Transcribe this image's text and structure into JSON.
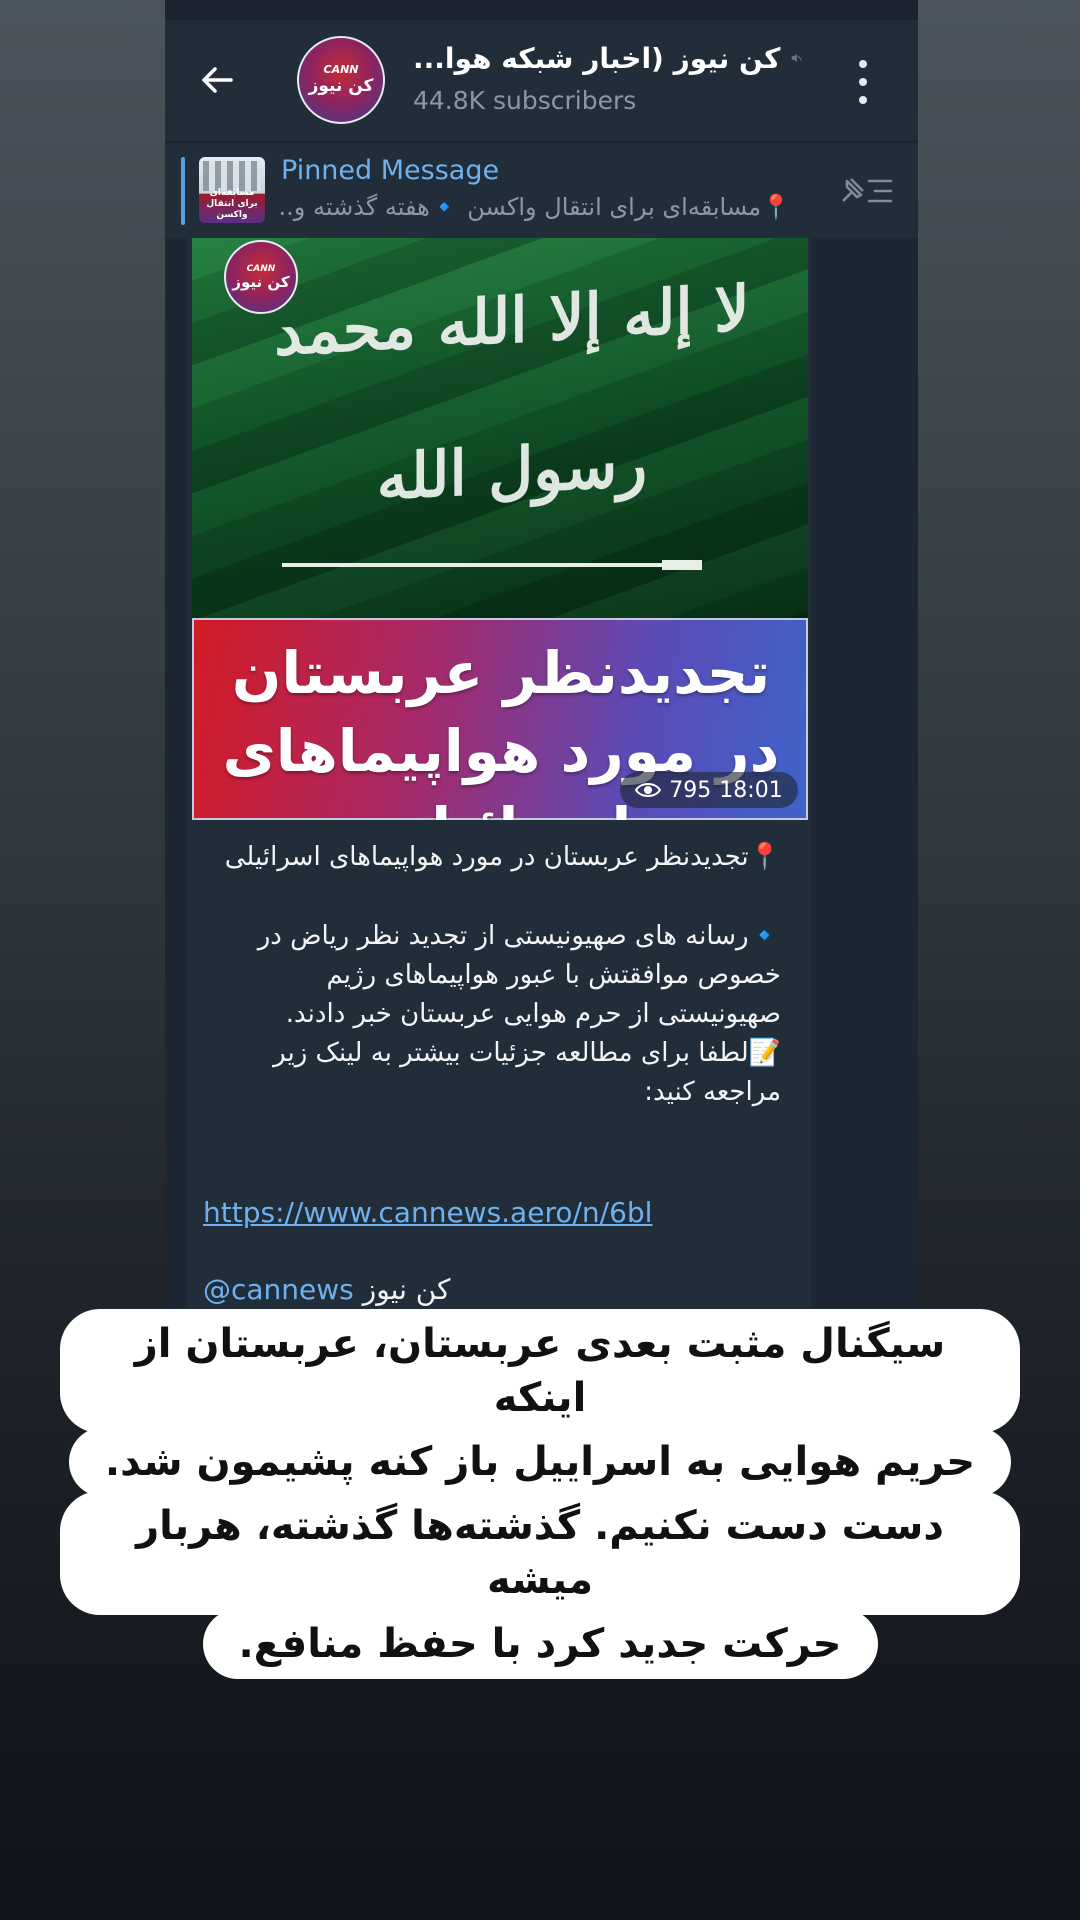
{
  "header": {
    "channel_title": "کن نیوز (اخبار شبکه هوا...",
    "subscribers": "44.8K subscribers",
    "avatar_logo_top": "CANN",
    "avatar_logo_main": "کن نیوز"
  },
  "pinned": {
    "label": "Pinned Message",
    "text": "📍مسابقه‌ای برای انتقال واکسن 🔹هفته گذشته و...",
    "thumb_text": "مسابقه‌ای برای انتقال واکسن"
  },
  "post": {
    "image_logo_top": "CANN",
    "image_logo_main": "کن نیوز",
    "flag_text": "لا إله إلا الله محمد رسول الله",
    "banner_title": "تجدیدنظر عربستان در مورد هواپیماهای اسرائیلی",
    "views": "795",
    "time": "18:01",
    "text_headline": "📍تجدیدنظر عربستان در مورد هواپیماهای اسرائیلی",
    "text_body": "🔹رسانه های صهیونیستی از تجدید نظر ریاض در خصوص موافقتش با عبور هواپیماهای رژیم صهیونیستی از حرم هوایی عربستان خبر دادند.",
    "text_more": "📝لطفا برای مطالعه جزئیات بیشتر به لینک زیر مراجعه کنید:",
    "link": "https://www.cannews.aero/n/6bl",
    "signature_name": "کن نیوز",
    "signature_handle": "@cannews"
  },
  "caption": {
    "line1": "سیگنال مثبت بعدی عربستان، عربستان از اینکه",
    "line2": "حریم هوایی به اسراییل باز کنه پشیمون شد.",
    "line3": "دست دست نکنیم. گذشته‌ها گذشته، هربار میشه",
    "line4": "حرکت جدید کرد با حفظ منافع."
  },
  "colors": {
    "header_bg": "#222d3a",
    "chat_bg": "#1d2733",
    "link": "#6fb1ee",
    "flag_green": "#1a7a3a",
    "banner_red": "#d41a24",
    "banner_blue": "#3e63c9"
  },
  "icons": {
    "back": "arrow-left-icon",
    "mute": "muted-speaker-icon",
    "menu": "vertical-dots-icon",
    "pin_list": "pin-list-icon",
    "views": "eye-icon"
  }
}
